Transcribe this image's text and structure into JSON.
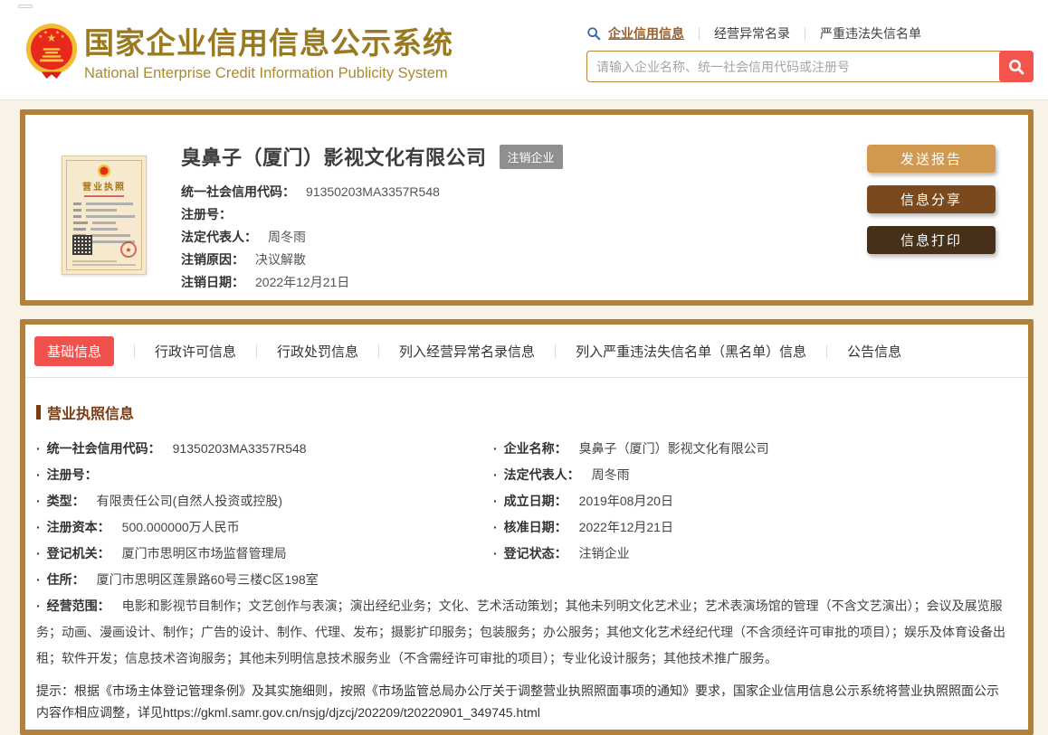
{
  "colors": {
    "brand_gold": "#9a7a20",
    "card_border_gold": "#b1803a",
    "search_button_red": "#f4544e",
    "active_tab_red": "#f0514d",
    "section_title_brown": "#7b3b13",
    "header_link_brown": "#9a5f2b",
    "status_badge_gray": "#8f8f8f",
    "button_send_bg": "#d0994f",
    "button_share_bg": "#7a4a1e",
    "button_print_bg": "#46301a",
    "search_icon_blue": "#3a66b0",
    "page_background": "#f8f3e6"
  },
  "header": {
    "title": "国家企业信用信息公示系统",
    "subtitle": "National Enterprise Credit Information Publicity System",
    "search_tabs": [
      {
        "label": "企业信用信息"
      },
      {
        "label": "经营异常名录"
      },
      {
        "label": "严重违法失信名单"
      }
    ],
    "search_placeholder": "请输入企业名称、统一社会信用代码或注册号"
  },
  "company_card": {
    "name": "臭鼻子（厦门）影视文化有限公司",
    "status_badge": "注销企业",
    "license_title": "营业执照",
    "fields": [
      {
        "label": "统一社会信用代码：",
        "value": "91350203MA3357R548"
      },
      {
        "label": "注册号：",
        "value": ""
      },
      {
        "label": "法定代表人：",
        "value": "周冬雨"
      },
      {
        "label": "注销原因：",
        "value": "决议解散"
      },
      {
        "label": "注销日期：",
        "value": "2022年12月21日"
      }
    ],
    "actions": [
      {
        "label": "发送报告"
      },
      {
        "label": "信息分享"
      },
      {
        "label": "信息打印"
      }
    ]
  },
  "nav_tabs": [
    {
      "label": "基础信息",
      "active": true
    },
    {
      "label": "行政许可信息",
      "active": false
    },
    {
      "label": "行政处罚信息",
      "active": false
    },
    {
      "label": "列入经营异常名录信息",
      "active": false
    },
    {
      "label": "列入严重违法失信名单（黑名单）信息",
      "active": false
    },
    {
      "label": "公告信息",
      "active": false
    }
  ],
  "basic_info": {
    "section_title": "营业执照信息",
    "rows": [
      {
        "l_label": "统一社会信用代码：",
        "l_value": "91350203MA3357R548",
        "r_label": "企业名称：",
        "r_value": "臭鼻子（厦门）影视文化有限公司"
      },
      {
        "l_label": "注册号：",
        "l_value": "",
        "r_label": "法定代表人：",
        "r_value": "周冬雨"
      },
      {
        "l_label": "类型：",
        "l_value": "有限责任公司(自然人投资或控股)",
        "r_label": "成立日期：",
        "r_value": "2019年08月20日"
      },
      {
        "l_label": "注册资本：",
        "l_value": "500.000000万人民币",
        "r_label": "核准日期：",
        "r_value": "2022年12月21日"
      },
      {
        "l_label": "登记机关：",
        "l_value": "厦门市思明区市场监督管理局",
        "r_label": "登记状态：",
        "r_value": "注销企业"
      }
    ],
    "address": {
      "label": "住所：",
      "value": "厦门市思明区莲景路60号三楼C区198室"
    },
    "business_scope": {
      "label": "经营范围：",
      "value": "电影和影视节目制作；文艺创作与表演；演出经纪业务；文化、艺术活动策划；其他未列明文化艺术业；艺术表演场馆的管理（不含文艺演出）；会议及展览服务；动画、漫画设计、制作；广告的设计、制作、代理、发布；摄影扩印服务；包装服务；办公服务；其他文化艺术经纪代理（不含须经许可审批的项目）；娱乐及体育设备出租；软件开发；信息技术咨询服务；其他未列明信息技术服务业（不含需经许可审批的项目）；专业化设计服务；其他技术推广服务。"
    },
    "notice": "提示：根据《市场主体登记管理条例》及其实施细则，按照《市场监管总局办公厅关于调整营业执照照面事项的通知》要求，国家企业信用信息公示系统将营业执照照面公示内容作相应调整，详见https://gkml.samr.gov.cn/nsjg/djzcj/202209/t20220901_349745.html"
  }
}
